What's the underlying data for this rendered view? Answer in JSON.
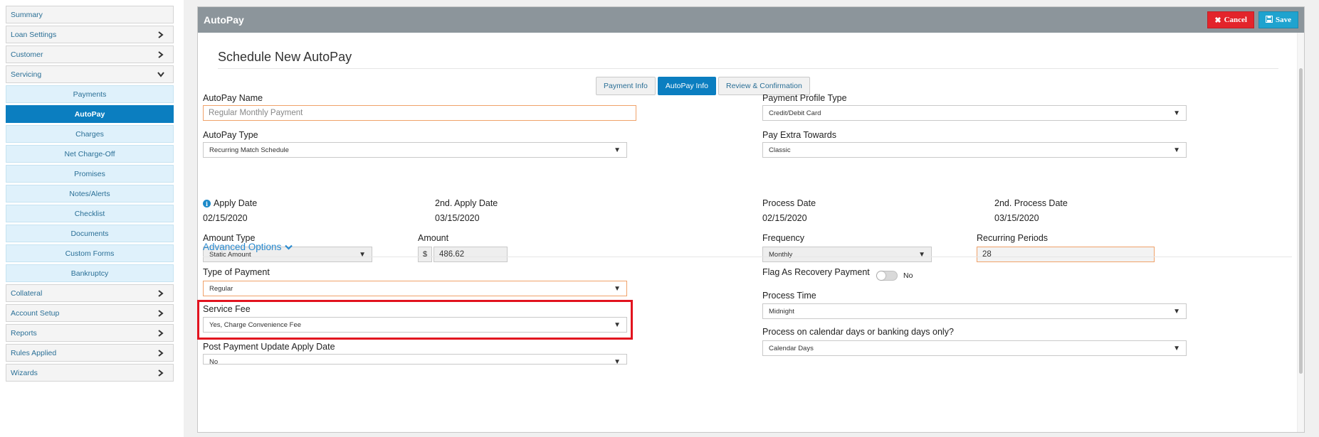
{
  "sidebar": {
    "items": [
      {
        "label": "Summary",
        "expandable": false
      },
      {
        "label": "Loan Settings",
        "expandable": true
      },
      {
        "label": "Customer",
        "expandable": true
      },
      {
        "label": "Servicing",
        "expandable": true,
        "expanded": true
      }
    ],
    "subitems": [
      {
        "label": "Payments"
      },
      {
        "label": "AutoPay",
        "active": true
      },
      {
        "label": "Charges"
      },
      {
        "label": "Net Charge-Off"
      },
      {
        "label": "Promises"
      },
      {
        "label": "Notes/Alerts"
      },
      {
        "label": "Checklist"
      },
      {
        "label": "Documents"
      },
      {
        "label": "Custom Forms"
      },
      {
        "label": "Bankruptcy"
      }
    ],
    "after": [
      {
        "label": "Collateral"
      },
      {
        "label": "Account Setup"
      },
      {
        "label": "Reports"
      },
      {
        "label": "Rules Applied"
      },
      {
        "label": "Wizards"
      }
    ]
  },
  "panel": {
    "title": "AutoPay",
    "cancel_label": "Cancel",
    "save_label": "Save"
  },
  "form": {
    "title": "Schedule New AutoPay",
    "tabs": [
      {
        "label": "Payment Info"
      },
      {
        "label": "AutoPay Info",
        "active": true
      },
      {
        "label": "Review & Confirmation"
      }
    ],
    "autopay_name": {
      "label": "AutoPay Name",
      "placeholder": "Regular Monthly Payment"
    },
    "payment_profile_type": {
      "label": "Payment Profile Type",
      "value": "Credit/Debit Card"
    },
    "autopay_type": {
      "label": "AutoPay Type",
      "value": "Recurring Match Schedule"
    },
    "pay_extra_towards": {
      "label": "Pay Extra Towards",
      "value": "Classic"
    },
    "apply_date": {
      "label": "Apply Date",
      "value": "02/15/2020"
    },
    "second_apply_date": {
      "label": "2nd. Apply Date",
      "value": "03/15/2020"
    },
    "process_date": {
      "label": "Process Date",
      "value": "02/15/2020"
    },
    "second_process_date": {
      "label": "2nd. Process Date",
      "value": "03/15/2020"
    },
    "amount_type": {
      "label": "Amount Type",
      "value": "Static Amount"
    },
    "amount": {
      "label": "Amount",
      "currency": "$",
      "value": "486.62"
    },
    "frequency": {
      "label": "Frequency",
      "value": "Monthly"
    },
    "recurring_periods": {
      "label": "Recurring Periods",
      "value": "28"
    },
    "advanced_options": {
      "label": "Advanced Options"
    },
    "type_of_payment": {
      "label": "Type of Payment",
      "value": "Regular"
    },
    "flag_recovery": {
      "label": "Flag As Recovery Payment",
      "state_label": "No"
    },
    "process_time": {
      "label": "Process Time",
      "value": "Midnight"
    },
    "service_fee": {
      "label": "Service Fee",
      "value": "Yes, Charge Convenience Fee"
    },
    "calendar_or_banking": {
      "label": "Process on calendar days or banking days only?",
      "value": "Calendar Days"
    },
    "post_payment_update": {
      "label": "Post Payment Update Apply Date",
      "value": "No"
    }
  },
  "colors": {
    "header_bg": "#8c959b",
    "accent": "#0b7ec0",
    "cancel": "#e3242b",
    "save": "#1fa3cf",
    "highlight": "#e2131f"
  }
}
